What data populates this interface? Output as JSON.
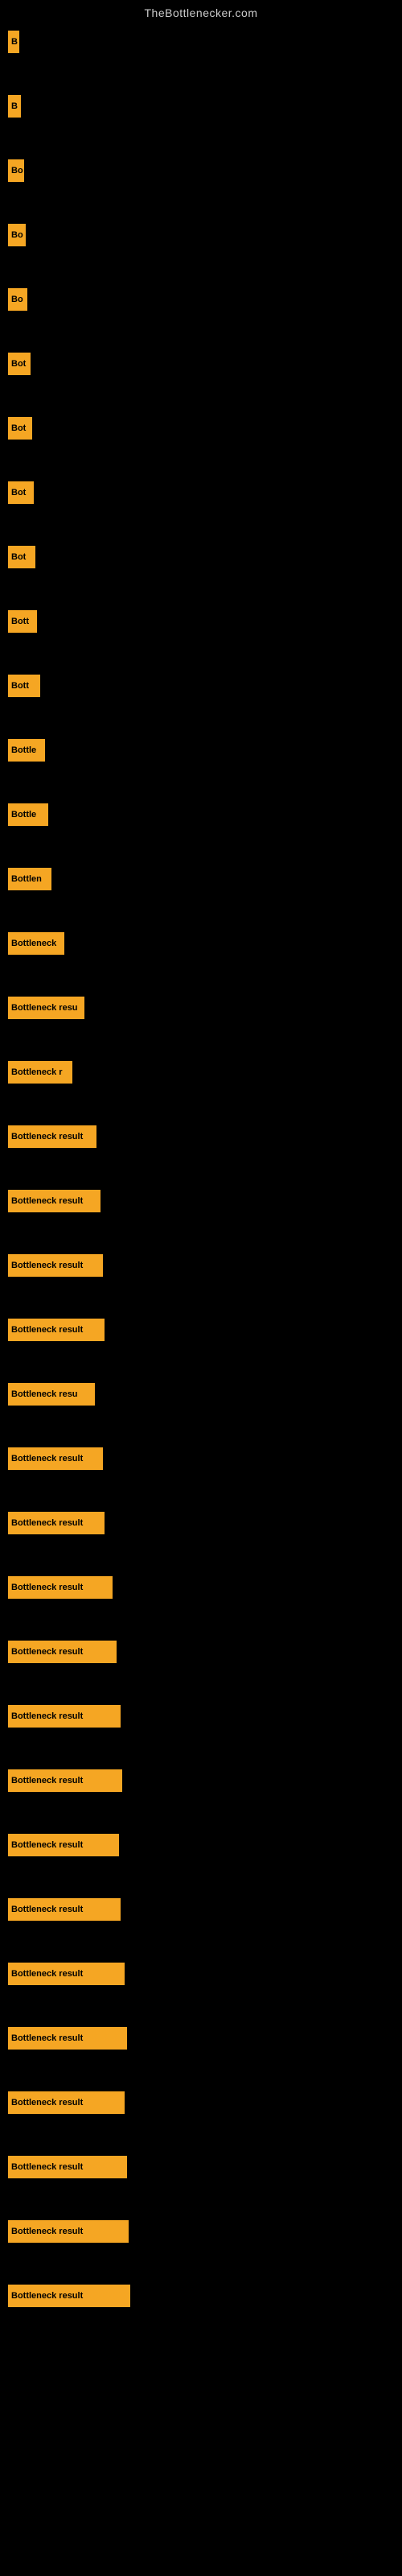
{
  "site_title": "TheBottlenecker.com",
  "bars": [
    {
      "label": "B",
      "width": 14
    },
    {
      "label": "B",
      "width": 16
    },
    {
      "label": "Bo",
      "width": 20
    },
    {
      "label": "Bo",
      "width": 22
    },
    {
      "label": "Bo",
      "width": 24
    },
    {
      "label": "Bot",
      "width": 28
    },
    {
      "label": "Bot",
      "width": 30
    },
    {
      "label": "Bot",
      "width": 32
    },
    {
      "label": "Bot",
      "width": 34
    },
    {
      "label": "Bott",
      "width": 36
    },
    {
      "label": "Bott",
      "width": 40
    },
    {
      "label": "Bottle",
      "width": 46
    },
    {
      "label": "Bottle",
      "width": 50
    },
    {
      "label": "Bottlen",
      "width": 54
    },
    {
      "label": "Bottleneck",
      "width": 70
    },
    {
      "label": "Bottleneck resu",
      "width": 95
    },
    {
      "label": "Bottleneck r",
      "width": 80
    },
    {
      "label": "Bottleneck result",
      "width": 110
    },
    {
      "label": "Bottleneck result",
      "width": 115
    },
    {
      "label": "Bottleneck result",
      "width": 118
    },
    {
      "label": "Bottleneck result",
      "width": 120
    },
    {
      "label": "Bottleneck resu",
      "width": 108
    },
    {
      "label": "Bottleneck result",
      "width": 118
    },
    {
      "label": "Bottleneck result",
      "width": 120
    },
    {
      "label": "Bottleneck result",
      "width": 130
    },
    {
      "label": "Bottleneck result",
      "width": 135
    },
    {
      "label": "Bottleneck result",
      "width": 140
    },
    {
      "label": "Bottleneck result",
      "width": 142
    },
    {
      "label": "Bottleneck result",
      "width": 138
    },
    {
      "label": "Bottleneck result",
      "width": 140
    },
    {
      "label": "Bottleneck result",
      "width": 145
    },
    {
      "label": "Bottleneck result",
      "width": 148
    },
    {
      "label": "Bottleneck result",
      "width": 145
    },
    {
      "label": "Bottleneck result",
      "width": 148
    },
    {
      "label": "Bottleneck result",
      "width": 150
    },
    {
      "label": "Bottleneck result",
      "width": 152
    }
  ]
}
